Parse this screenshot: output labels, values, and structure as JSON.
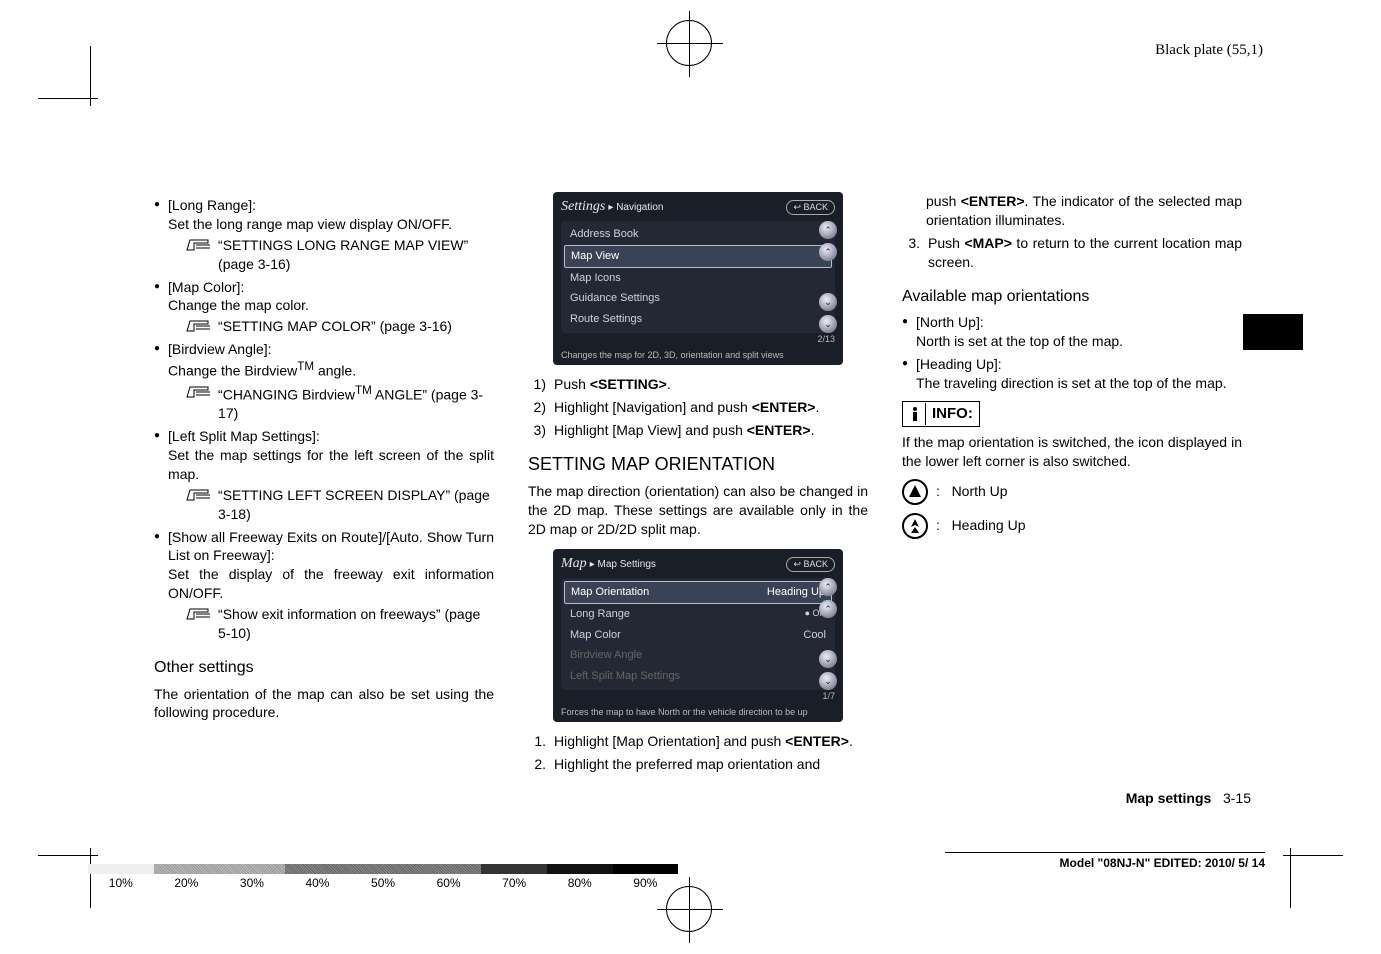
{
  "header": {
    "plate": "Black plate (55,1)"
  },
  "col1": {
    "items": [
      {
        "title": "[Long Range]:",
        "desc": "Set the long range map view display ON/OFF.",
        "ref": "“SETTINGS LONG RANGE MAP VIEW” (page 3-16)"
      },
      {
        "title": "[Map Color]:",
        "desc": "Change the map color.",
        "ref": "“SETTING MAP COLOR” (page 3-16)"
      },
      {
        "title": "[Birdview Angle]:",
        "desc_pre": "Change the Birdview",
        "desc_post": " angle.",
        "ref_pre": "“CHANGING Birdview",
        "ref_post": " ANGLE” (page 3-17)"
      },
      {
        "title": "[Left Split Map Settings]:",
        "desc": "Set the map settings for the left screen of the split map.",
        "ref": "“SETTING LEFT SCREEN DISPLAY” (page 3-18)"
      },
      {
        "title": "[Show all Freeway Exits on Route]/[Auto. Show Turn List on Freeway]:",
        "desc": "Set the display of the freeway exit information ON/OFF.",
        "ref": "“Show exit information on freeways” (page 5-10)"
      }
    ],
    "subhead": "Other settings",
    "tail": "The orientation of the map can also be set using the following procedure."
  },
  "col2": {
    "ss1": {
      "title": "Settings",
      "crumb": "▸ Navigation",
      "back": "↩ BACK",
      "items": [
        "Address Book",
        "Map View",
        "Map Icons",
        "Guidance Settings",
        "Route Settings"
      ],
      "pager": "2/13",
      "foot": "Changes the map for 2D, 3D, orientation and split views"
    },
    "steps1": [
      {
        "n": "1)",
        "t_pre": "Push ",
        "t_bold": "<SETTING>",
        "t_post": "."
      },
      {
        "n": "2)",
        "t_pre": "Highlight [Navigation] and push ",
        "t_bold": "<ENTER>",
        "t_post": "."
      },
      {
        "n": "3)",
        "t_pre": "Highlight [Map View] and push ",
        "t_bold": "<ENTER>",
        "t_post": "."
      }
    ],
    "section": "SETTING MAP ORIENTATION",
    "para": "The map direction (orientation) can also be changed in the 2D map. These settings are available only in the 2D map or 2D/2D split map.",
    "ss2": {
      "title": "Map",
      "crumb": "▸ Map Settings",
      "back": "↩ BACK",
      "rows": [
        {
          "l": "Map Orientation",
          "r": "Heading Up",
          "sel": true
        },
        {
          "l": "Long Range",
          "r": "● ON"
        },
        {
          "l": "Map Color",
          "r": "Cool"
        },
        {
          "l": "Birdview Angle",
          "r": "",
          "dis": true
        },
        {
          "l": "Left Split Map Settings",
          "r": "",
          "dis": true
        }
      ],
      "pager": "1/7",
      "foot": "Forces the map to have North or the vehicle direction to be up"
    },
    "steps2": [
      {
        "n": "1.",
        "t_pre": "Highlight [Map Orientation] and push ",
        "t_bold": "<ENTER>",
        "t_post": "."
      },
      {
        "n": "2.",
        "t_pre": "Highlight the preferred map orientation and",
        "t_bold": "",
        "t_post": ""
      }
    ]
  },
  "col3": {
    "cont": {
      "pre": "push ",
      "b": "<ENTER>",
      "post": ". The indicator of the selected map orientation illuminates."
    },
    "step3": {
      "n": "3.",
      "pre": "Push ",
      "b": "<MAP>",
      "post": " to return to the current location map screen."
    },
    "subhead": "Available map orientations",
    "bullets": [
      {
        "t": "[North Up]:",
        "d": "North is set at the top of the map."
      },
      {
        "t": "[Heading Up]:",
        "d": "The traveling direction is set at the top of the map."
      }
    ],
    "info_label": "INFO:",
    "info_text": "If the map orientation is switched, the icon displayed in the lower left corner is also switched.",
    "legend": [
      {
        "k": "north",
        "label": "North Up"
      },
      {
        "k": "heading",
        "label": "Heading Up"
      }
    ]
  },
  "footer": {
    "page_label": "Map settings",
    "page_num": "3-15",
    "model": "Model \"08NJ-N\"  EDITED: 2010/ 5/ 14",
    "ruler": [
      "10%",
      "20%",
      "30%",
      "40%",
      "50%",
      "60%",
      "70%",
      "80%",
      "90%"
    ]
  }
}
